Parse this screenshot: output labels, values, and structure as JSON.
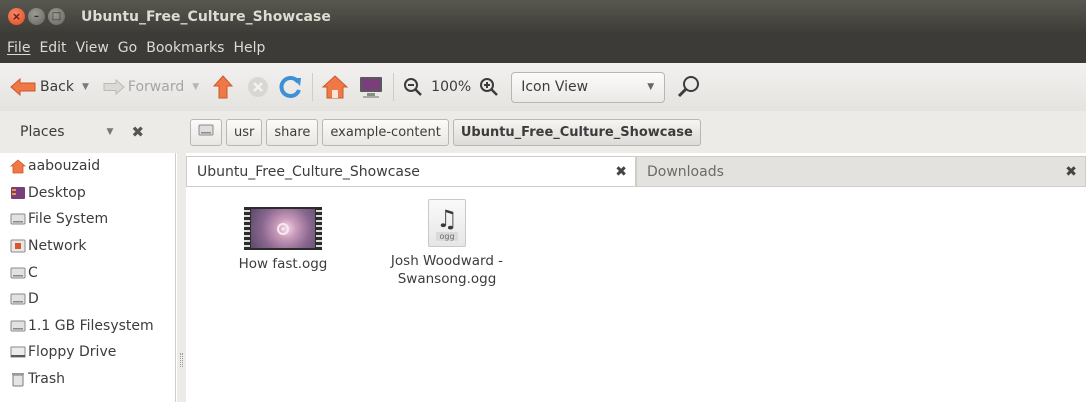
{
  "window": {
    "title": "Ubuntu_Free_Culture_Showcase",
    "controls": {
      "close": "×",
      "minimize": "–",
      "maximize": "□"
    }
  },
  "menubar": [
    "File",
    "Edit",
    "View",
    "Go",
    "Bookmarks",
    "Help"
  ],
  "toolbar": {
    "back_label": "Back",
    "forward_label": "Forward",
    "zoom_level": "100%",
    "view_mode": "Icon View",
    "icons": [
      "back-arrow-icon",
      "forward-arrow-icon",
      "up-arrow-icon",
      "stop-icon",
      "reload-icon",
      "home-icon",
      "computer-icon",
      "zoom-out-icon",
      "zoom-in-icon",
      "search-icon"
    ]
  },
  "location": {
    "places_label": "Places",
    "path": [
      "usr",
      "share",
      "example-content",
      "Ubuntu_Free_Culture_Showcase"
    ]
  },
  "sidebar": {
    "items": [
      {
        "label": "aabouzaid",
        "icon": "home-folder-icon"
      },
      {
        "label": "Desktop",
        "icon": "desktop-icon"
      },
      {
        "label": "File System",
        "icon": "drive-icon"
      },
      {
        "label": "Network",
        "icon": "network-icon"
      },
      {
        "label": "C",
        "icon": "drive-icon"
      },
      {
        "label": "D",
        "icon": "drive-icon"
      },
      {
        "label": "1.1 GB Filesystem",
        "icon": "drive-icon"
      },
      {
        "label": "Floppy Drive",
        "icon": "floppy-icon"
      },
      {
        "label": "Trash",
        "icon": "trash-icon"
      }
    ]
  },
  "tabs": [
    {
      "label": "Ubuntu_Free_Culture_Showcase",
      "active": true
    },
    {
      "label": "Downloads",
      "active": false
    }
  ],
  "files": [
    {
      "name": "How fast.ogg",
      "type": "video"
    },
    {
      "name": "Josh Woodward - Swansong.ogg",
      "type": "audio",
      "ext": "ogg"
    }
  ],
  "colors": {
    "titlebar": "#3c3b37",
    "close_button": "#e04a1b",
    "home_orange": "#f07746",
    "up_arrow": "#f07746",
    "reload_blue": "#3d8fd6"
  }
}
